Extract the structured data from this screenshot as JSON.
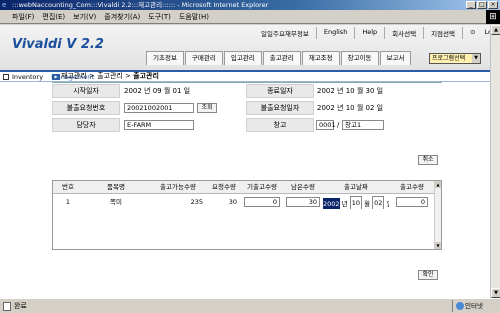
{
  "window": {
    "title": ":::webNaccounting_Com:::Vivaldi 2.2:::재고관리:::::: - Microsoft Internet Explorer",
    "controls": [
      "_",
      "□",
      "×"
    ]
  },
  "menubar": [
    "파일(F)",
    "편집(E)",
    "보기(V)",
    "즐겨찾기(A)",
    "도구(T)",
    "도움말(H)"
  ],
  "app": {
    "logo": "Vivaldi  V 2.2",
    "toplinks": [
      "일일주요재무정보",
      "English",
      "Help",
      "회사선택",
      "지점선택",
      "Logout"
    ],
    "tabs": [
      "기초정보",
      "구매관리",
      "입고관리",
      "출고관리",
      "재고조정",
      "창고이동",
      "보고서"
    ],
    "program_select": "프로그램선택",
    "subnav": {
      "left": "Inventory",
      "right": "Management"
    }
  },
  "breadcrumb": {
    "path": "재고관리 > 출고관리 > ",
    "current": "출고관리"
  },
  "form": {
    "start_date_label": "시작일자",
    "start_date": "2002 년 09 월 01 일",
    "end_date_label": "종료일자",
    "end_date": "2002 년 10 월 30 일",
    "request_no_label": "불출요청번호",
    "request_no": "20021002001",
    "lookup_btn": "조회",
    "request_date_label": "불출요청일자",
    "request_date": "2002 년 10 월 02 일",
    "manager_label": "담당자",
    "manager": "E-FARM",
    "warehouse_label": "창고",
    "warehouse_code": "0001",
    "warehouse_sep": "/",
    "warehouse_name": "창고1",
    "cancel_btn": "취소"
  },
  "grid": {
    "headers": [
      "번호",
      "품목명",
      "출고가능수량",
      "요청수량",
      "기출고수량",
      "남은수량",
      "출고날짜",
      "출고수량"
    ],
    "rows": [
      {
        "no": "1",
        "item": "쪽미",
        "available": "235",
        "requested": "30",
        "shipped": "0",
        "remaining": "30",
        "date_year": "2002",
        "date_month": "10",
        "date_day": "02",
        "y": "년",
        "m": "월",
        "d": "일",
        "qty": "0"
      }
    ]
  },
  "confirm_btn": "확인",
  "status": {
    "text": "완료",
    "zone": "인터넷"
  }
}
